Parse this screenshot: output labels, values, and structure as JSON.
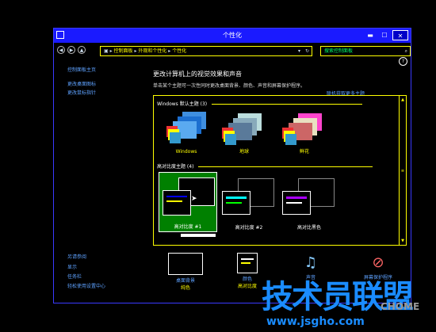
{
  "window": {
    "title": "个性化"
  },
  "address": {
    "path": [
      "控制面板",
      "外观和个性化",
      "个性化"
    ],
    "search_placeholder": "搜索控制面板"
  },
  "sidebar": {
    "top": [
      "控制面板主页",
      "更改桌面图标",
      "更改鼠标指针"
    ],
    "see_also": "另请参阅",
    "bottom": [
      "显示",
      "任务栏",
      "轻松使用设置中心"
    ]
  },
  "main": {
    "heading": "更改计算机上的视觉效果和声音",
    "description": "单击某个主题可一次性同时更改桌面背景、颜色、声音和屏幕保护程序。",
    "online_link": "联机获取更多主题",
    "sections": [
      {
        "label": "Windows 默认主题 (3)",
        "themes": [
          "Windows",
          "地球",
          "鲜花"
        ]
      },
      {
        "label": "高对比度主题 (4)",
        "themes": [
          "高对比度 #1",
          "高对比度 #2",
          "高对比黑色"
        ]
      }
    ]
  },
  "bottom_bar": [
    {
      "label": "桌面背景",
      "sub": "纯色"
    },
    {
      "label": "颜色",
      "sub": "高对比度"
    },
    {
      "label": "声音",
      "sub": ""
    },
    {
      "label": "屏幕保护程序",
      "sub": ""
    }
  ],
  "watermark": {
    "main": "技术员联盟",
    "url": "www.jsgho.com",
    "corner": "CHOME"
  },
  "colors": {
    "accent": "#ffff00",
    "link": "#5ea2ff",
    "titlebar": "#1a1aff",
    "selected": "#008000"
  }
}
